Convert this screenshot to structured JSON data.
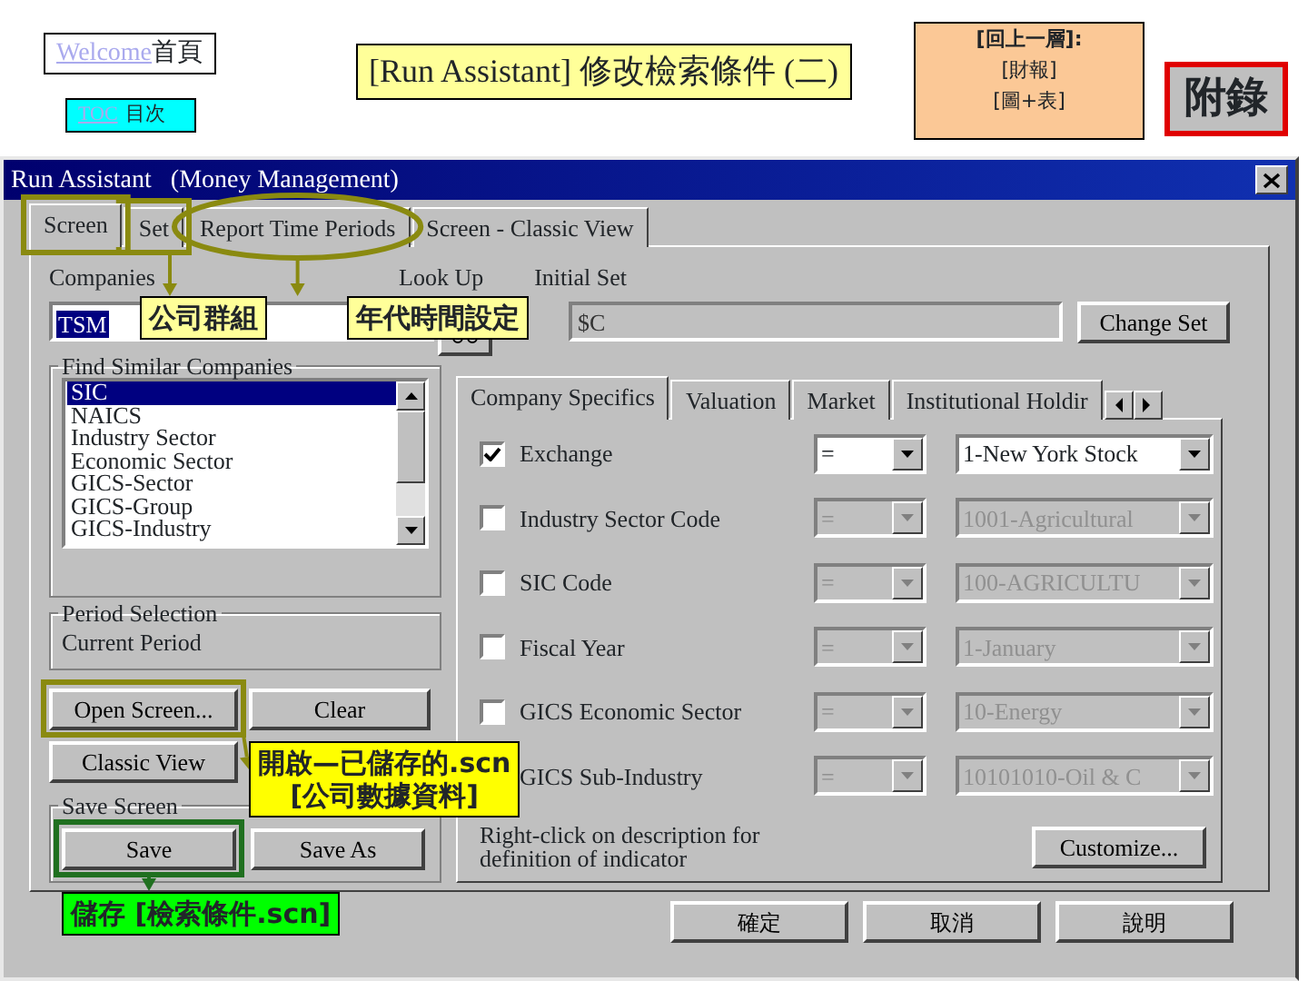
{
  "slide": {
    "home_link": {
      "link": "Welcome",
      "text": "首頁"
    },
    "toc_link": {
      "link": "TOC",
      "text": "目次"
    },
    "title": "[Run Assistant] 修改檢索條件 (二)",
    "nav_box": {
      "heading": "[回上一層]:",
      "lines": [
        "[財報]",
        "[圖+表]"
      ]
    },
    "appendix": "附錄"
  },
  "window": {
    "title": "Run Assistant   (Money Management)"
  },
  "tabs": [
    {
      "label": "Screen",
      "selected": true
    },
    {
      "label": "Set",
      "selected": false
    },
    {
      "label": "Report Time Periods",
      "selected": false
    },
    {
      "label": "Screen - Classic View",
      "selected": false
    }
  ],
  "companies": {
    "label": "Companies",
    "value": "TSM"
  },
  "lookup": {
    "label": "Look Up"
  },
  "initial_set": {
    "label": "Initial Set",
    "value": "$C"
  },
  "change_set": "Change Set",
  "find_similar": {
    "legend": "Find Similar Companies",
    "items": [
      {
        "label": "SIC",
        "selected": true
      },
      {
        "label": "NAICS",
        "selected": false
      },
      {
        "label": "Industry Sector",
        "selected": false
      },
      {
        "label": "Economic Sector",
        "selected": false
      },
      {
        "label": "GICS-Sector",
        "selected": false
      },
      {
        "label": "GICS-Group",
        "selected": false
      },
      {
        "label": "GICS-Industry",
        "selected": false
      }
    ]
  },
  "period": {
    "legend": "Period Selection",
    "value": "Current Period"
  },
  "left_buttons": [
    "Open Screen...",
    "Clear",
    "Classic View"
  ],
  "save_screen": {
    "legend": "Save Screen",
    "buttons": [
      "Save",
      "Save As"
    ]
  },
  "criteria_tabs": [
    {
      "label": "Company Specifics",
      "selected": true
    },
    {
      "label": "Valuation",
      "selected": false
    },
    {
      "label": "Market",
      "selected": false
    },
    {
      "label": "Institutional Holdir",
      "selected": false
    }
  ],
  "criteria": [
    {
      "checked": true,
      "label": "Exchange",
      "operator": "=",
      "value": "1-New York Stock",
      "disabled": false
    },
    {
      "checked": false,
      "label": "Industry Sector Code",
      "operator": "=",
      "value": "1001-Agricultural",
      "disabled": true
    },
    {
      "checked": false,
      "label": "SIC Code",
      "operator": "=",
      "value": "100-AGRICULTU",
      "disabled": true
    },
    {
      "checked": false,
      "label": "Fiscal Year",
      "operator": "=",
      "value": "1-January",
      "disabled": true
    },
    {
      "checked": false,
      "label": "GICS Economic Sector",
      "operator": "=",
      "value": "10-Energy",
      "disabled": true
    },
    {
      "label": "GICS Sub-Industry",
      "operator": "=",
      "value": "10101010-Oil & C",
      "disabled": true
    }
  ],
  "hint": "Right-click on description for definition of indicator",
  "customize": "Customize...",
  "footer_buttons": [
    "確定",
    "取消",
    "說明"
  ],
  "annotations": [
    {
      "text": "公司群組",
      "color": "#ffff99"
    },
    {
      "text": "年代時間設定",
      "color": "#ffff99"
    },
    {
      "text": "開啟—已儲存的.scn\n[公司數據資料]",
      "color": "#ffff00"
    },
    {
      "text": "儲存 [檢索條件.scn]",
      "color": "#00ff00"
    }
  ]
}
